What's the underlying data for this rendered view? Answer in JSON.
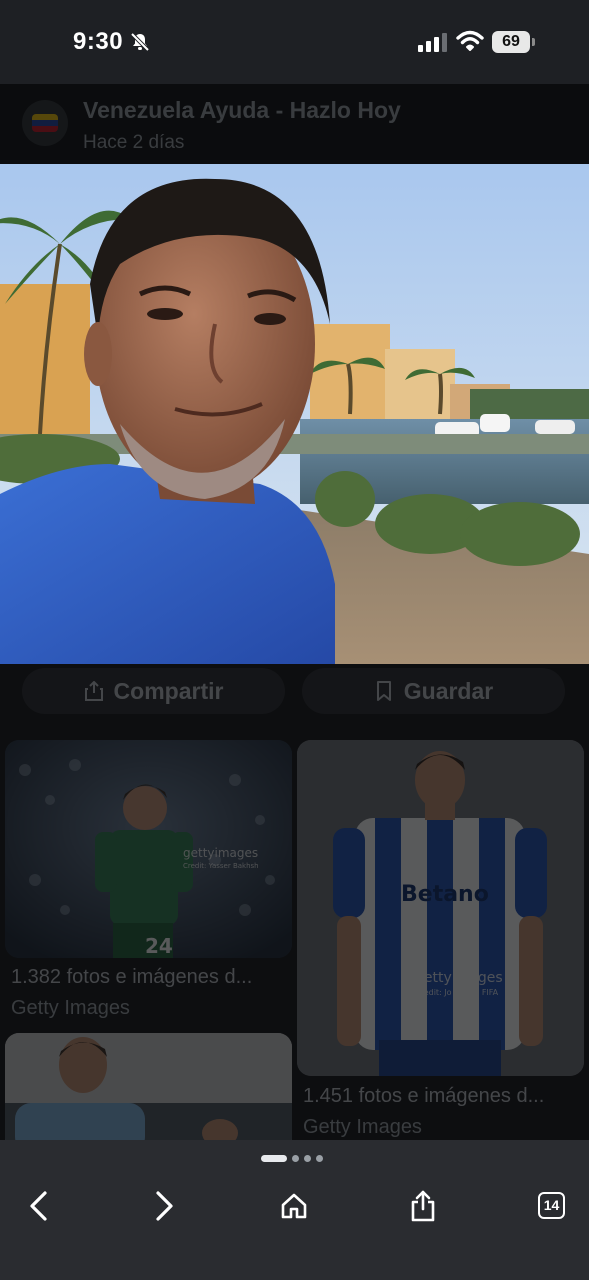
{
  "status_bar": {
    "time": "9:30",
    "battery_percent": "69",
    "icons": [
      "bell-off-icon",
      "signal-icon",
      "wifi-icon",
      "battery-icon"
    ]
  },
  "source": {
    "title": "Venezuela Ayuda - Hazlo Hoy",
    "time_ago": "Hace 2 días"
  },
  "actions": {
    "share_label": "Compartir",
    "save_label": "Guardar"
  },
  "related": [
    {
      "caption": "1.382 fotos e imágenes d...",
      "source": "Getty Images",
      "watermark": "gettyimages",
      "credit": "Credit: Yasser Bakhsh",
      "jersey_number": "24"
    },
    {
      "caption": "1.451 fotos e imágenes d...",
      "source": "Getty Images",
      "watermark": "gettyimages",
      "credit": "Credit: Jo Bello - FIFA",
      "jersey_text": "Betano"
    }
  ],
  "bottom_nav": {
    "tab_count": "14",
    "page_dots": 4,
    "active_dot": 0
  },
  "colors": {
    "background": "#0d0e10",
    "status_bar": "#1e2024",
    "bottom_bar": "#2a2c30",
    "shirt_blue": "#2f5ec4"
  }
}
